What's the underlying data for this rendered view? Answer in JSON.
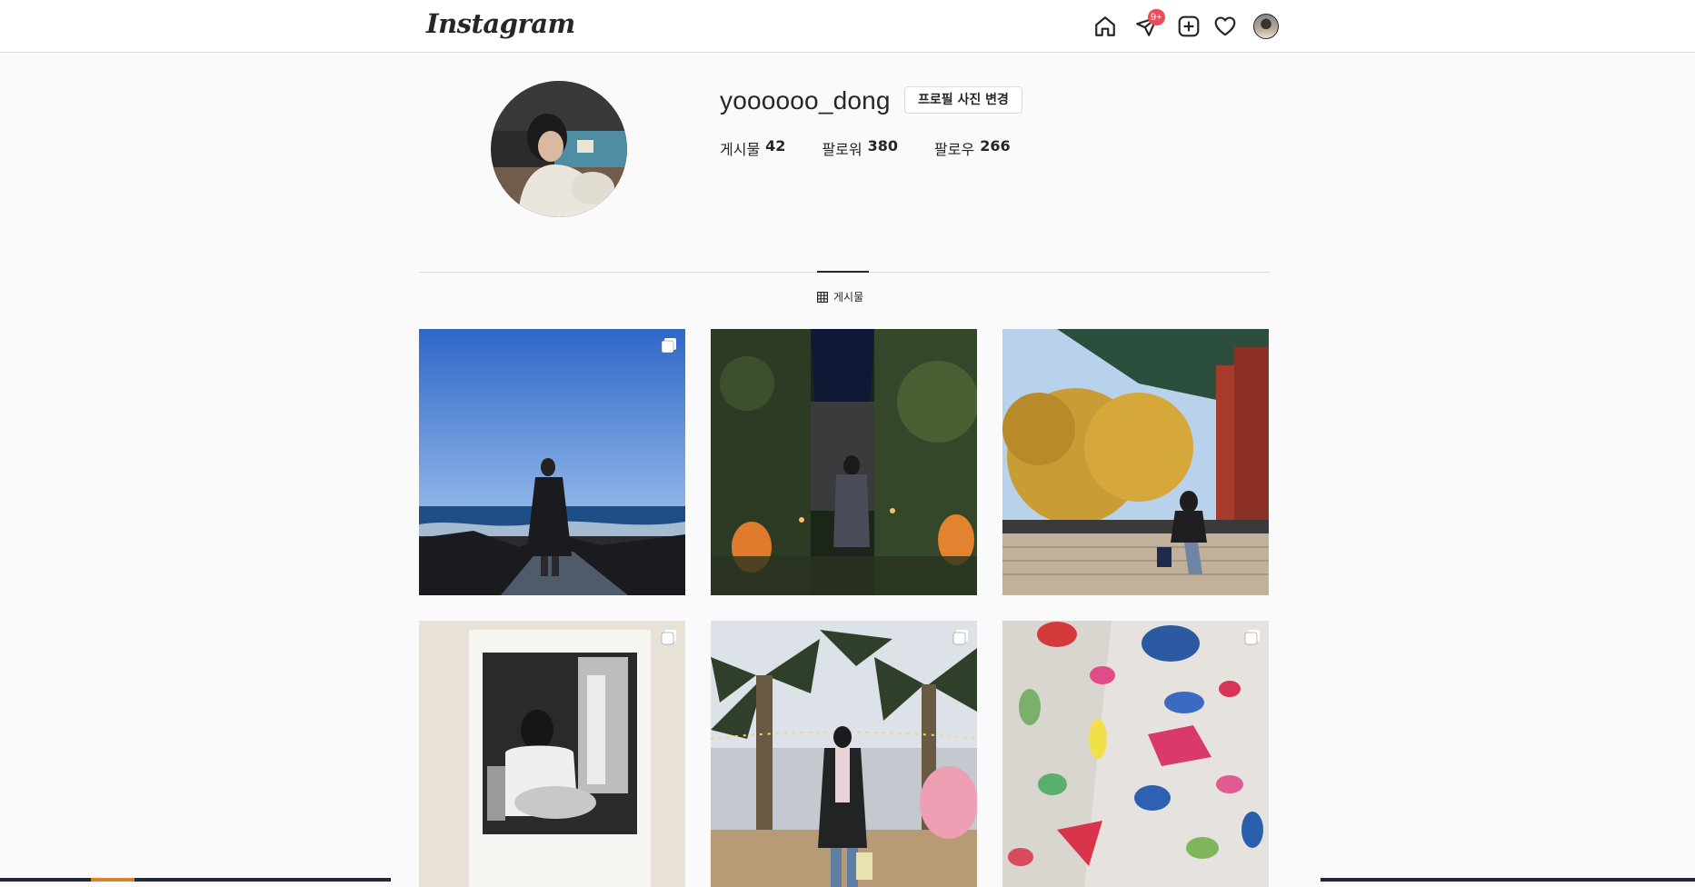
{
  "header": {
    "logo_text": "Instagram",
    "icons": [
      "home-icon",
      "direct-icon",
      "new-post-icon",
      "activity-icon",
      "profile-avatar"
    ],
    "direct_badge": "9+"
  },
  "profile": {
    "username": "yoooooo_dong",
    "edit_button": "프로필 사진 변경",
    "stats": [
      {
        "label": "게시물",
        "value": "42"
      },
      {
        "label": "팔로워",
        "value": "380"
      },
      {
        "label": "팔로우",
        "value": "266"
      }
    ]
  },
  "tabs": {
    "posts_label": "게시물"
  },
  "posts": [
    {
      "scene": "sea",
      "multi": true
    },
    {
      "scene": "night-garden",
      "multi": false
    },
    {
      "scene": "autumn-palace",
      "multi": false
    },
    {
      "scene": "polaroid",
      "multi": true
    },
    {
      "scene": "palm-night",
      "multi": true
    },
    {
      "scene": "climbing-wall",
      "multi": true
    }
  ],
  "colors": {
    "accent_badge": "#ed4956",
    "text": "#262626",
    "border": "#dbdbdb",
    "background": "#fafafa"
  }
}
